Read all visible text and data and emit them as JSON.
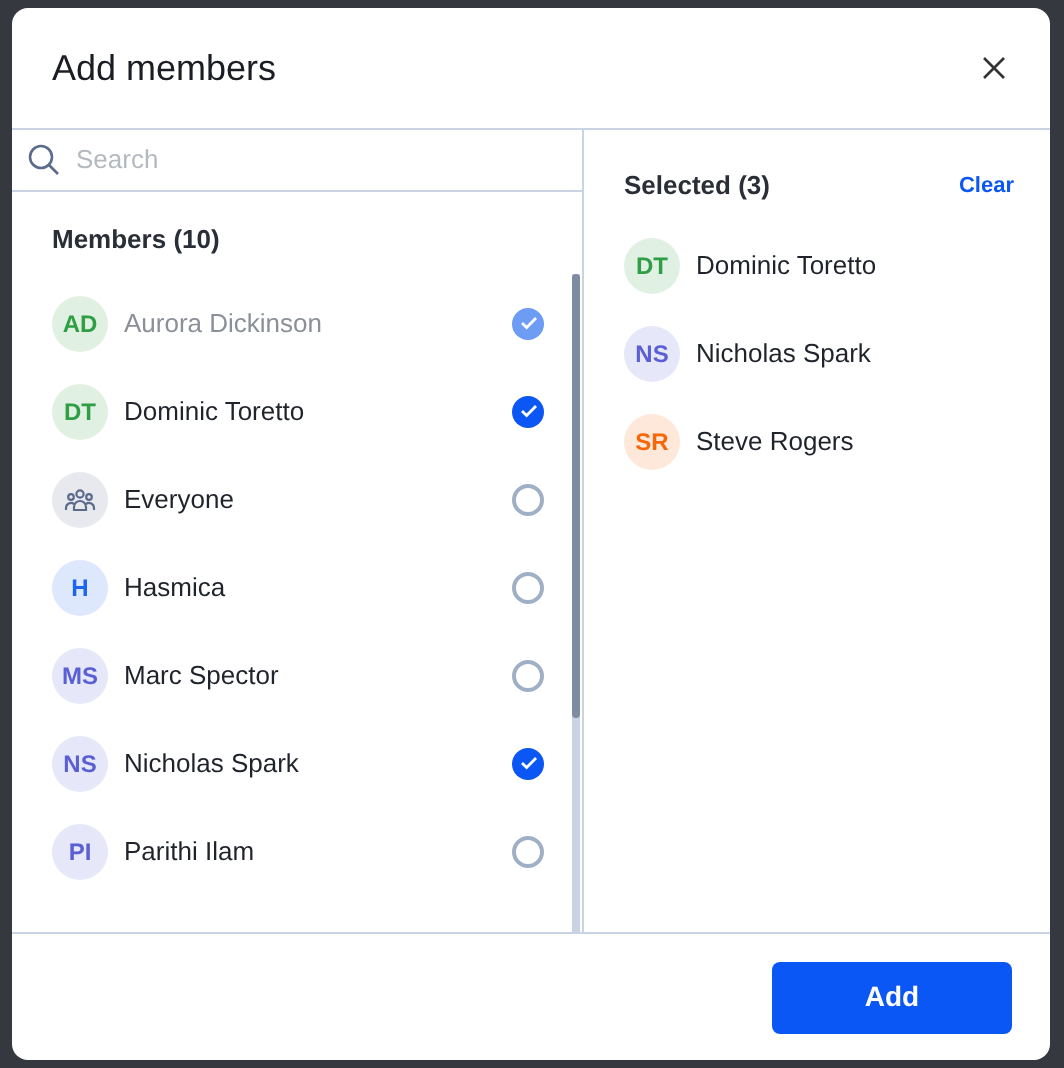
{
  "dialog": {
    "title": "Add members"
  },
  "search": {
    "placeholder": "Search"
  },
  "members": {
    "heading": "Members (10)",
    "items": [
      {
        "kind": "person",
        "initials": "AD",
        "name": "Aurora Dickinson",
        "color": "#2f9e44",
        "checked": true,
        "disabled": true
      },
      {
        "kind": "person",
        "initials": "DT",
        "name": "Dominic Toretto",
        "color": "#2f9e44",
        "checked": true,
        "disabled": false
      },
      {
        "kind": "group",
        "name": "Everyone",
        "color": "#5b6b8c",
        "checked": false,
        "disabled": false
      },
      {
        "kind": "person",
        "initials": "H",
        "name": "Hasmica",
        "color": "#1c64f2",
        "checked": false,
        "disabled": false
      },
      {
        "kind": "person",
        "initials": "MS",
        "name": "Marc Spector",
        "color": "#5a5fd6",
        "checked": false,
        "disabled": false
      },
      {
        "kind": "person",
        "initials": "NS",
        "name": "Nicholas Spark",
        "color": "#5a5fd6",
        "checked": true,
        "disabled": false
      },
      {
        "kind": "person",
        "initials": "PI",
        "name": "Parithi Ilam",
        "color": "#5a5fd6",
        "checked": false,
        "disabled": false
      }
    ]
  },
  "selected": {
    "heading": "Selected (3)",
    "clear": "Clear",
    "items": [
      {
        "initials": "DT",
        "name": "Dominic Toretto",
        "color": "#2f9e44"
      },
      {
        "initials": "NS",
        "name": "Nicholas Spark",
        "color": "#5a5fd6"
      },
      {
        "initials": "SR",
        "name": "Steve Rogers",
        "color": "#f76707"
      }
    ]
  },
  "footer": {
    "button": "Add"
  }
}
